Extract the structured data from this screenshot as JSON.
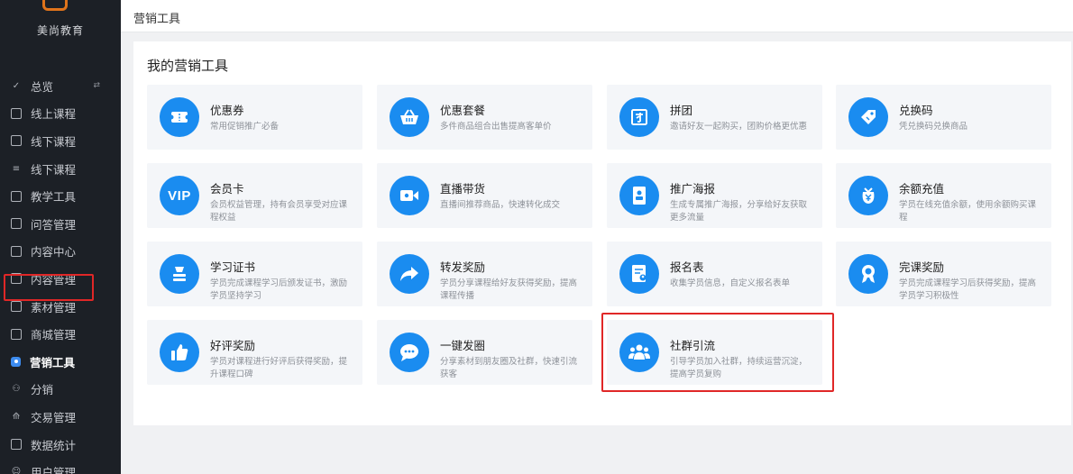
{
  "brand": {
    "name": "美尚教育"
  },
  "sidebar": {
    "items": [
      {
        "label": "总览",
        "extra": "⇄"
      },
      {
        "label": "线上课程"
      },
      {
        "label": "线下课程"
      },
      {
        "label": "线下课程"
      },
      {
        "label": "教学工具"
      },
      {
        "label": "问答管理"
      },
      {
        "label": "内容中心"
      },
      {
        "label": "内容管理"
      },
      {
        "label": "素材管理"
      },
      {
        "label": "商城管理"
      },
      {
        "label": "营销工具"
      },
      {
        "label": "分销"
      },
      {
        "label": "交易管理"
      },
      {
        "label": "数据统计"
      },
      {
        "label": "用户管理"
      }
    ],
    "active_label": "营销工具"
  },
  "header": {
    "breadcrumb": "营销工具"
  },
  "panel": {
    "title": "我的营销工具",
    "tools": [
      {
        "title": "优惠券",
        "desc": "常用促销推广必备",
        "icon": "coupon-icon"
      },
      {
        "title": "优惠套餐",
        "desc": "多件商品组合出售提高客单价",
        "icon": "basket-icon"
      },
      {
        "title": "拼团",
        "desc": "邀请好友一起购买，团购价格更优惠",
        "icon": "group-buy-icon"
      },
      {
        "title": "兑换码",
        "desc": "凭兑换码兑换商品",
        "icon": "tag-icon"
      },
      {
        "title": "会员卡",
        "desc": "会员权益管理，持有会员享受对应课程权益",
        "icon": "vip-icon"
      },
      {
        "title": "直播带货",
        "desc": "直播间推荐商品，快速转化成交",
        "icon": "video-camera-icon"
      },
      {
        "title": "推广海报",
        "desc": "生成专属推广海报，分享给好友获取更多流量",
        "icon": "poster-icon"
      },
      {
        "title": "余额充值",
        "desc": "学员在线充值余额，使用余额购买课程",
        "icon": "wallet-icon"
      },
      {
        "title": "学习证书",
        "desc": "学员完成课程学习后颁发证书，激励学员坚持学习",
        "icon": "certificate-icon"
      },
      {
        "title": "转发奖励",
        "desc": "学员分享课程给好友获得奖励，提高课程传播",
        "icon": "share-icon"
      },
      {
        "title": "报名表",
        "desc": "收集学员信息，自定义报名表单",
        "icon": "form-icon"
      },
      {
        "title": "完课奖励",
        "desc": "学员完成课程学习后获得奖励，提高学员学习积极性",
        "icon": "medal-icon"
      },
      {
        "title": "好评奖励",
        "desc": "学员对课程进行好评后获得奖励，提升课程口碑",
        "icon": "thumbs-up-icon"
      },
      {
        "title": "一键发圈",
        "desc": "分享素材到朋友圈及社群，快速引流获客",
        "icon": "chat-bubble-icon"
      },
      {
        "title": "社群引流",
        "desc": "引导学员加入社群，持续运营沉淀，提高学员复购",
        "icon": "community-icon"
      }
    ]
  },
  "colors": {
    "accent": "#1a8cf0",
    "highlight": "#e02727",
    "sidebar_bg": "#1c2026"
  }
}
